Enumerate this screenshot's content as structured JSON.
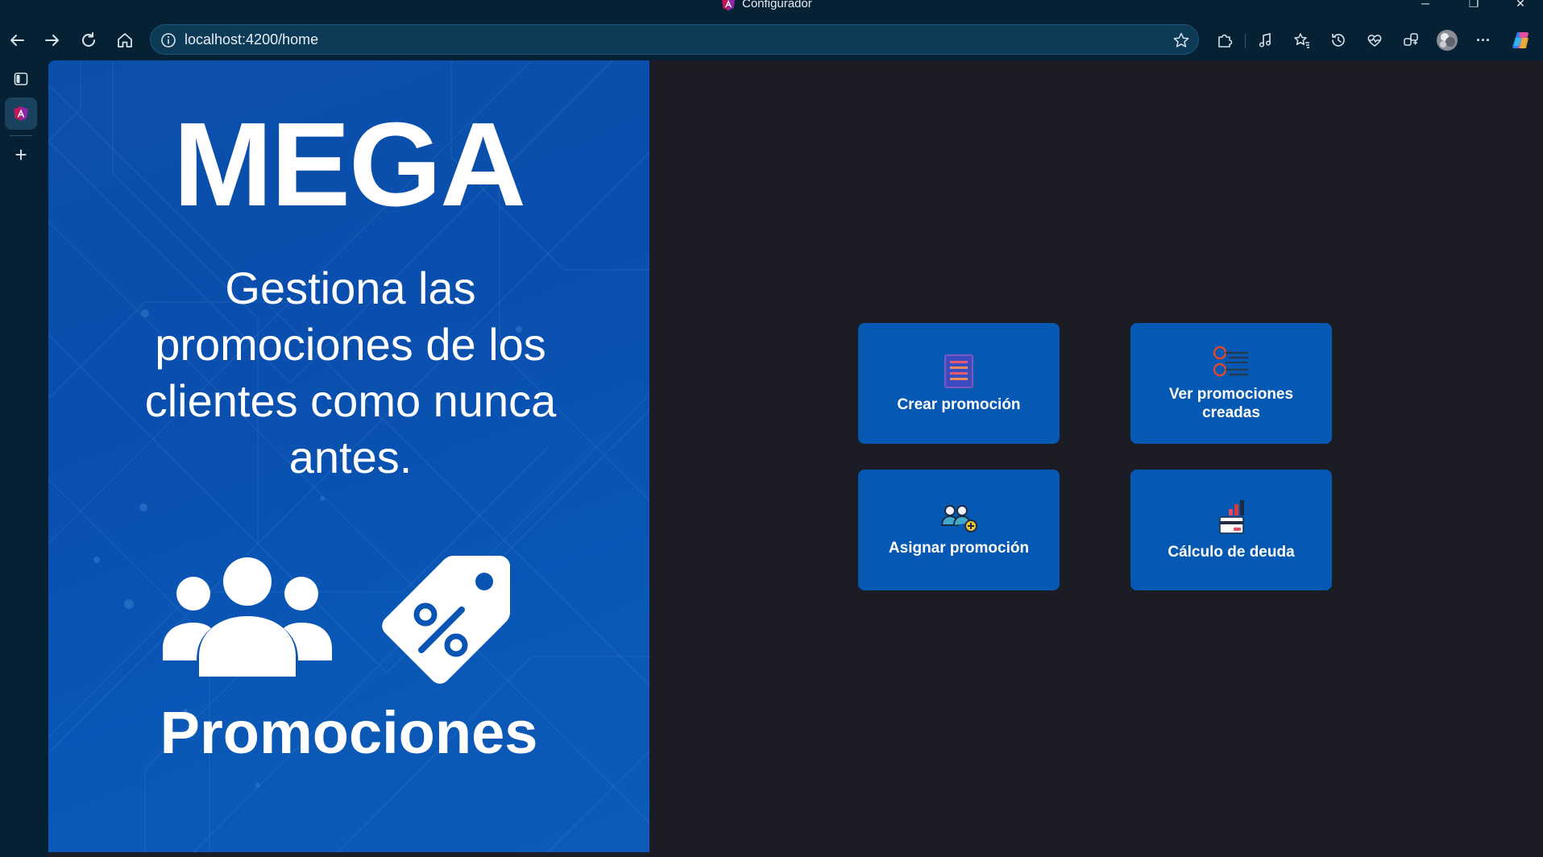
{
  "window": {
    "title": "Configurador",
    "controls": {
      "minimize": "─",
      "restore": "❐",
      "close": "✕"
    }
  },
  "toolbar": {
    "url_host": "localhost",
    "url_rest": ":4200/home",
    "more_label": "···"
  },
  "vertical_tabs": {
    "new_tab_label": "+"
  },
  "hero": {
    "title": "MEGA",
    "tagline": "Gestiona las promociones de los clientes como nunca antes.",
    "caption": "Promociones"
  },
  "actions": [
    {
      "label": "Crear promoción",
      "icon": "document-list-icon"
    },
    {
      "label": "Ver promociones creadas",
      "icon": "checklist-icon"
    },
    {
      "label": "Asignar promoción",
      "icon": "assign-users-icon"
    },
    {
      "label": "Cálculo de deuda",
      "icon": "debt-card-chart-icon"
    }
  ],
  "colors": {
    "page_bg": "#1b1c26",
    "browser_chrome": "#062134",
    "panel_blue": "#0a4fae",
    "card_blue": "#0659b3"
  }
}
